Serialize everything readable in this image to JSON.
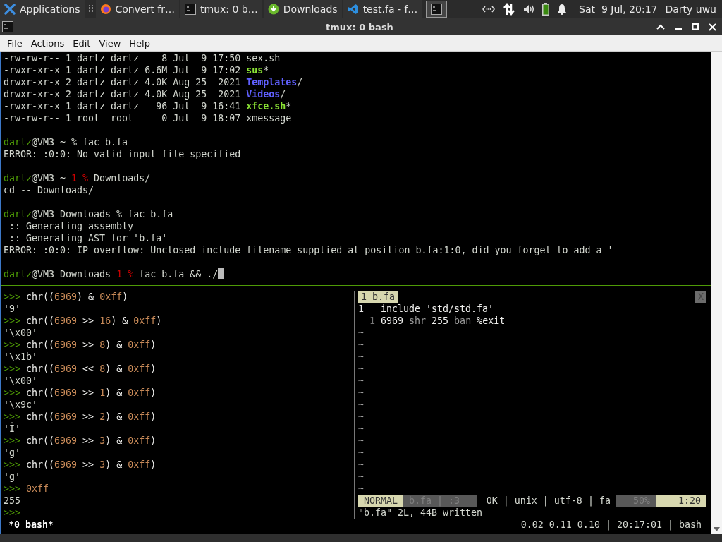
{
  "taskbar": {
    "tasks": [
      {
        "label": "Applications",
        "kind": "app-menu"
      },
      {
        "label": "Convert fr…",
        "kind": "browser"
      },
      {
        "label": "tmux: 0 b…",
        "kind": "terminal"
      },
      {
        "label": "Downloads",
        "kind": "download"
      },
      {
        "label": "test.fa - f…",
        "kind": "editor"
      }
    ],
    "clock": "Sat  9 Jul, 20:17",
    "user": "Darty uwu"
  },
  "window": {
    "title": "tmux: 0 bash"
  },
  "menu": [
    "File",
    "Actions",
    "Edit",
    "View",
    "Help"
  ],
  "top_pane": {
    "blocks": [
      [
        {
          "segments": [
            {
              "text": "-rw-rw-r-- 1 dartz dartz    8 Jul  9 17:50 sex.sh",
              "kind": "plain"
            }
          ]
        },
        {
          "segments": [
            {
              "text": "-rwxr-xr-x 1 dartz dartz 6.6M Jul  9 17:02 ",
              "kind": "plain"
            },
            {
              "text": "sus",
              "kind": "exec"
            },
            {
              "text": "*",
              "kind": "plain"
            }
          ]
        },
        {
          "segments": [
            {
              "text": "drwxr-xr-x 2 dartz dartz 4.0K Aug 25  2021 ",
              "kind": "plain"
            },
            {
              "text": "Templates",
              "kind": "dir"
            },
            {
              "text": "/",
              "kind": "plain"
            }
          ]
        },
        {
          "segments": [
            {
              "text": "drwxr-xr-x 2 dartz dartz 4.0K Aug 25  2021 ",
              "kind": "plain"
            },
            {
              "text": "Videos",
              "kind": "dir"
            },
            {
              "text": "/",
              "kind": "plain"
            }
          ]
        },
        {
          "segments": [
            {
              "text": "-rwxr-xr-x 1 dartz dartz   96 Jul  9 16:41 ",
              "kind": "plain"
            },
            {
              "text": "xfce.sh",
              "kind": "exec"
            },
            {
              "text": "*",
              "kind": "plain"
            }
          ]
        },
        {
          "segments": [
            {
              "text": "-rw-rw-r-- 1 root  root     0 Jul  9 18:07 xmessage",
              "kind": "plain"
            }
          ]
        }
      ],
      [
        {
          "segments": [
            {
              "text": "dartz",
              "kind": "user"
            },
            {
              "text": "@VM3 ~ % fac b.fa",
              "kind": "plain"
            }
          ]
        },
        {
          "segments": [
            {
              "text": "ERROR: :0:0: No valid input file specified",
              "kind": "plain"
            }
          ]
        }
      ],
      [
        {
          "segments": [
            {
              "text": "dartz",
              "kind": "user"
            },
            {
              "text": "@VM3 ~ ",
              "kind": "plain"
            },
            {
              "text": "1 %",
              "kind": "red"
            },
            {
              "text": " Downloads/",
              "kind": "plain"
            }
          ]
        },
        {
          "segments": [
            {
              "text": "cd -- Downloads/",
              "kind": "plain"
            }
          ]
        }
      ],
      [
        {
          "segments": [
            {
              "text": "dartz",
              "kind": "user"
            },
            {
              "text": "@VM3 Downloads % fac b.fa",
              "kind": "plain"
            }
          ]
        },
        {
          "segments": [
            {
              "text": " :: Generating assembly",
              "kind": "plain"
            }
          ]
        },
        {
          "segments": [
            {
              "text": " :: Generating AST for 'b.fa'",
              "kind": "plain"
            }
          ]
        },
        {
          "segments": [
            {
              "text": "ERROR: :0:0: IP overflow: Unclosed include filename supplied at position b.fa:1:0, did you forget to add a '",
              "kind": "plain"
            }
          ]
        }
      ],
      [
        {
          "segments": [
            {
              "text": "dartz",
              "kind": "user"
            },
            {
              "text": "@VM3 Downloads ",
              "kind": "plain"
            },
            {
              "text": "1 %",
              "kind": "red"
            },
            {
              "text": " fac b.fa && ./",
              "kind": "plain"
            }
          ],
          "cursor": true
        }
      ]
    ]
  },
  "python_pane": {
    "lines": [
      {
        "segments": [
          {
            "text": ">>>",
            "kind": "prompt"
          },
          {
            "text": " chr((",
            "kind": "code"
          },
          {
            "text": "6969",
            "kind": "num"
          },
          {
            "text": ") & ",
            "kind": "code"
          },
          {
            "text": "0xff",
            "kind": "num"
          },
          {
            "text": ")",
            "kind": "code"
          }
        ]
      },
      {
        "segments": [
          {
            "text": "'9'",
            "kind": "plain"
          }
        ]
      },
      {
        "segments": [
          {
            "text": ">>>",
            "kind": "prompt"
          },
          {
            "text": " chr((",
            "kind": "code"
          },
          {
            "text": "6969",
            "kind": "num"
          },
          {
            "text": " >> ",
            "kind": "code"
          },
          {
            "text": "16",
            "kind": "num"
          },
          {
            "text": ") & ",
            "kind": "code"
          },
          {
            "text": "0xff",
            "kind": "num"
          },
          {
            "text": ")",
            "kind": "code"
          }
        ]
      },
      {
        "segments": [
          {
            "text": "'\\x00'",
            "kind": "plain"
          }
        ]
      },
      {
        "segments": [
          {
            "text": ">>>",
            "kind": "prompt"
          },
          {
            "text": " chr((",
            "kind": "code"
          },
          {
            "text": "6969",
            "kind": "num"
          },
          {
            "text": " >> ",
            "kind": "code"
          },
          {
            "text": "8",
            "kind": "num"
          },
          {
            "text": ") & ",
            "kind": "code"
          },
          {
            "text": "0xff",
            "kind": "num"
          },
          {
            "text": ")",
            "kind": "code"
          }
        ]
      },
      {
        "segments": [
          {
            "text": "'\\x1b'",
            "kind": "plain"
          }
        ]
      },
      {
        "segments": [
          {
            "text": ">>>",
            "kind": "prompt"
          },
          {
            "text": " chr((",
            "kind": "code"
          },
          {
            "text": "6969",
            "kind": "num"
          },
          {
            "text": " << ",
            "kind": "code"
          },
          {
            "text": "8",
            "kind": "num"
          },
          {
            "text": ") & ",
            "kind": "code"
          },
          {
            "text": "0xff",
            "kind": "num"
          },
          {
            "text": ")",
            "kind": "code"
          }
        ]
      },
      {
        "segments": [
          {
            "text": "'\\x00'",
            "kind": "plain"
          }
        ]
      },
      {
        "segments": [
          {
            "text": ">>>",
            "kind": "prompt"
          },
          {
            "text": " chr((",
            "kind": "code"
          },
          {
            "text": "6969",
            "kind": "num"
          },
          {
            "text": " >> ",
            "kind": "code"
          },
          {
            "text": "1",
            "kind": "num"
          },
          {
            "text": ") & ",
            "kind": "code"
          },
          {
            "text": "0xff",
            "kind": "num"
          },
          {
            "text": ")",
            "kind": "code"
          }
        ]
      },
      {
        "segments": [
          {
            "text": "'\\x9c'",
            "kind": "plain"
          }
        ]
      },
      {
        "segments": [
          {
            "text": ">>>",
            "kind": "prompt"
          },
          {
            "text": " chr((",
            "kind": "code"
          },
          {
            "text": "6969",
            "kind": "num"
          },
          {
            "text": " >> ",
            "kind": "code"
          },
          {
            "text": "2",
            "kind": "num"
          },
          {
            "text": ") & ",
            "kind": "code"
          },
          {
            "text": "0xff",
            "kind": "num"
          },
          {
            "text": ")",
            "kind": "code"
          }
        ]
      },
      {
        "segments": [
          {
            "text": "'Î'",
            "kind": "plain"
          }
        ]
      },
      {
        "segments": [
          {
            "text": ">>>",
            "kind": "prompt"
          },
          {
            "text": " chr((",
            "kind": "code"
          },
          {
            "text": "6969",
            "kind": "num"
          },
          {
            "text": " >> ",
            "kind": "code"
          },
          {
            "text": "3",
            "kind": "num"
          },
          {
            "text": ") & ",
            "kind": "code"
          },
          {
            "text": "0xff",
            "kind": "num"
          },
          {
            "text": ")",
            "kind": "code"
          }
        ]
      },
      {
        "segments": [
          {
            "text": "'g'",
            "kind": "plain"
          }
        ]
      },
      {
        "segments": [
          {
            "text": ">>>",
            "kind": "prompt"
          },
          {
            "text": " chr((",
            "kind": "code"
          },
          {
            "text": "6969",
            "kind": "num"
          },
          {
            "text": " >> ",
            "kind": "code"
          },
          {
            "text": "3",
            "kind": "num"
          },
          {
            "text": ") & ",
            "kind": "code"
          },
          {
            "text": "0xff",
            "kind": "num"
          },
          {
            "text": ")",
            "kind": "code"
          }
        ]
      },
      {
        "segments": [
          {
            "text": "'g'",
            "kind": "plain"
          }
        ]
      },
      {
        "segments": [
          {
            "text": ">>>",
            "kind": "prompt"
          },
          {
            "text": " 0xff",
            "kind": "num"
          }
        ]
      },
      {
        "segments": [
          {
            "text": "255",
            "kind": "plain"
          }
        ]
      },
      {
        "segments": [
          {
            "text": ">>>",
            "kind": "prompt"
          }
        ]
      }
    ]
  },
  "vim_pane": {
    "tab": "1 b.fa",
    "close": "X",
    "lines": [
      {
        "number": "1",
        "current": true,
        "segments": [
          {
            "text": "include 'std/std.fa'",
            "kind": "code"
          }
        ]
      },
      {
        "number": "1",
        "current": false,
        "segments": [
          {
            "text": "6969",
            "kind": "code"
          },
          {
            "text": " shr ",
            "kind": "dim"
          },
          {
            "text": "255",
            "kind": "code"
          },
          {
            "text": " ban ",
            "kind": "dim"
          },
          {
            "text": "%exit",
            "kind": "code"
          }
        ]
      }
    ],
    "filler": [
      "~",
      "~",
      "~",
      "~",
      "~",
      "~",
      "~",
      "~",
      "~",
      "~",
      "~",
      "~",
      "~",
      "~"
    ],
    "status": {
      "mode": "NORMAL",
      "file": "b.fa | :3",
      "info": "OK | unix | utf-8 | fa",
      "percent": "50%",
      "position": "1:20"
    },
    "message": "\"b.fa\" 2L, 44B written"
  },
  "tmux_status": {
    "window": "*0 bash*",
    "right": "0.02 0.11 0.10 | 20:17:01 | bash"
  }
}
